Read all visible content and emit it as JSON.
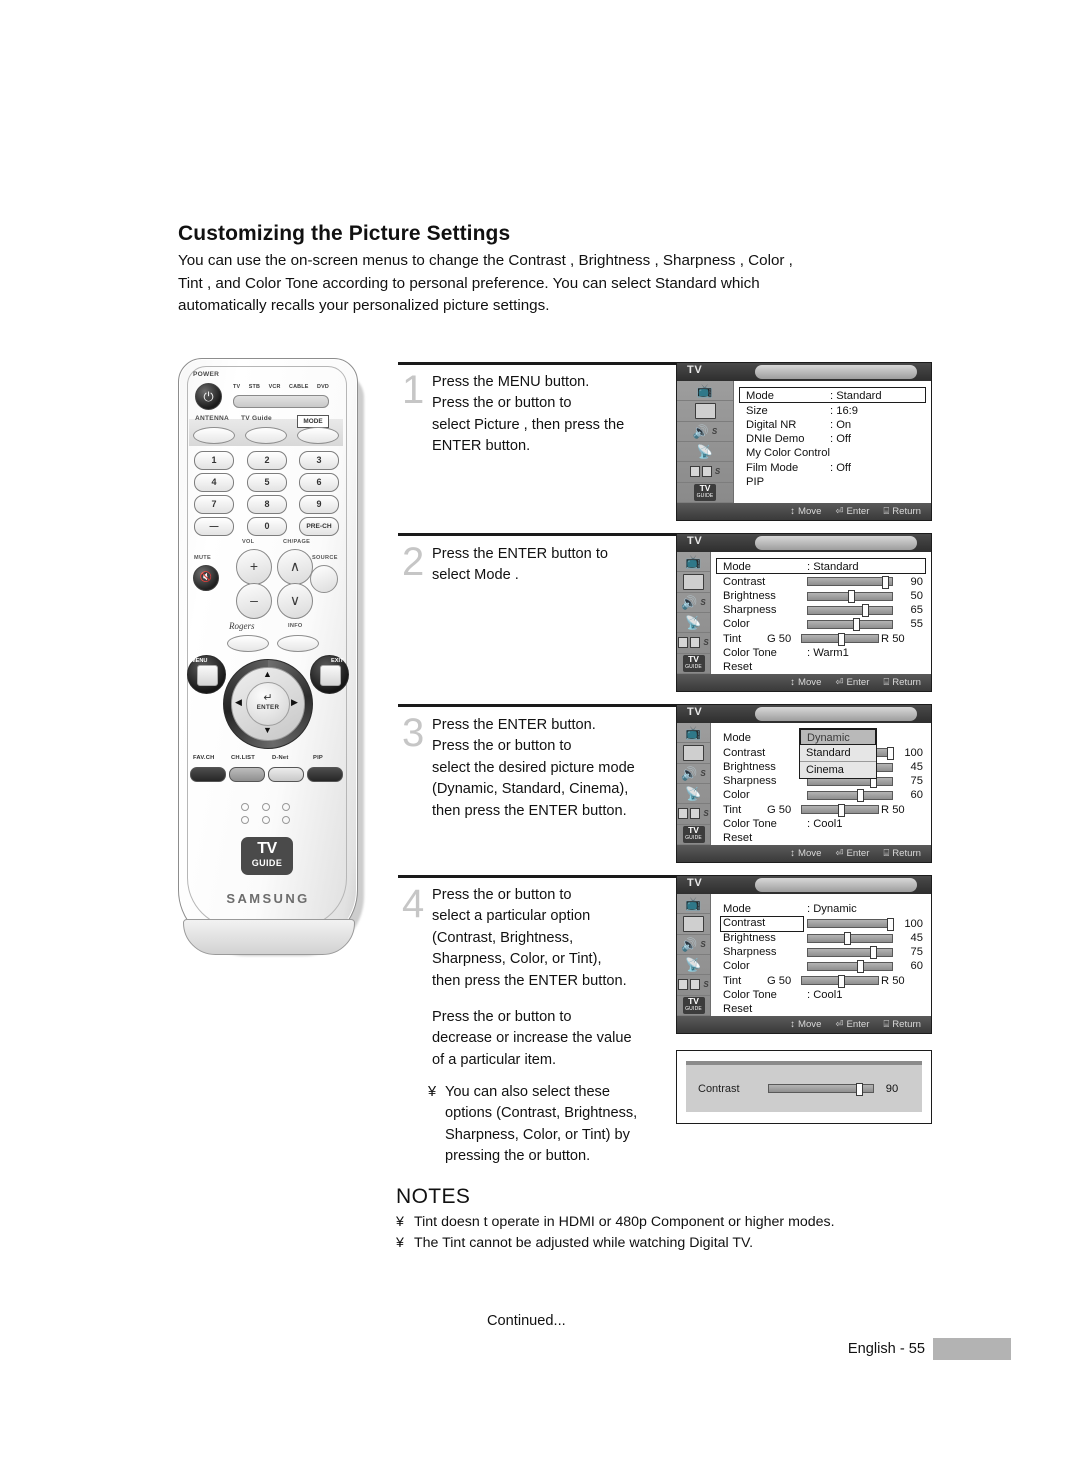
{
  "heading": "Customizing the Picture Settings",
  "intro": [
    "You can use the on-screen menus to change the  Contrast ,  Brightness ,  Sharpness ,  Color ,",
    " Tint , and  Color Tone  according to personal preference. You can select  Standard  which",
    "automatically recalls your personalized picture settings."
  ],
  "remote": {
    "power_label": "POWER",
    "power_icon": "power-icon",
    "device_keys": [
      "TV",
      "STB",
      "VCR",
      "CABLE",
      "DVD"
    ],
    "antenna_label": "ANTENNA",
    "tvguide_label": "TV Guide",
    "mode_label": "MODE",
    "numbers": [
      "1",
      "2",
      "3",
      "4",
      "5",
      "6",
      "7",
      "8",
      "9",
      "—",
      "0",
      "PRE-CH"
    ],
    "mute_label": "MUTE",
    "vol_label": "VOL",
    "chpage_label": "CH/PAGE",
    "source_label": "SOURCE",
    "vol_up": "+",
    "vol_down": "–",
    "ch_up": "∧",
    "ch_down": "∨",
    "rogers_label": "Rogers",
    "info_label": "INFO",
    "menu_label": "MENU",
    "exit_label": "EXIT",
    "enter_label": "ENTER",
    "bottom_keys": [
      "FAV.CH",
      "CH.LIST",
      "D-Net",
      "PIP"
    ],
    "tvguide_logo_line1": "TV",
    "tvguide_logo_line2": "GUIDE",
    "brand": "SAMSUNG"
  },
  "steps": [
    {
      "number": "1",
      "lines": [
        "Press the MENU button.",
        "Press the   or     button to",
        "select  Picture , then press the",
        "ENTER button."
      ]
    },
    {
      "number": "2",
      "lines": [
        "Press the ENTER button to",
        "select  Mode ."
      ]
    },
    {
      "number": "3",
      "lines": [
        "Press the ENTER button.",
        "Press the   or     button to",
        "select the desired picture mode",
        "(Dynamic, Standard, Cinema),",
        "then press the ENTER button."
      ]
    },
    {
      "number": "4",
      "lines": [
        "Press the   or     button to",
        "select a particular option",
        "(Contrast, Brightness,",
        "Sharpness, Color, or Tint),",
        "then press the ENTER button."
      ]
    }
  ],
  "step4_extra": {
    "lines": [
      "Press the   or     button to",
      "decrease or increase the value",
      "of a particular item."
    ],
    "bullet_mark": "¥",
    "bullet_lines": [
      "You can also select these",
      "options (Contrast, Brightness,",
      "Sharpness, Color, or Tint) by",
      "pressing the   or    button."
    ]
  },
  "osd_common": {
    "tv_tag": "TV",
    "footer": [
      {
        "icon": "↕",
        "label": "Move"
      },
      {
        "icon": "⏎",
        "label": "Enter"
      },
      {
        "icon": "⌸",
        "label": "Return"
      }
    ],
    "sidebar_icons": [
      "input-source-icon",
      "picture-icon",
      "sound-icon",
      "channel-dish-icon",
      "setup-icon",
      "tv-guide-icon"
    ],
    "sound_badge": "S",
    "setup_badge": "S",
    "tvguide_line1": "TV",
    "tvguide_line2": "GUIDE"
  },
  "osd1": {
    "rows": [
      {
        "label": "Mode",
        "value": ": Standard",
        "highlight": true
      },
      {
        "label": "Size",
        "value": ": 16:9"
      },
      {
        "label": "Digital NR",
        "value": ": On"
      },
      {
        "label": "DNIe Demo",
        "value": ": Off"
      },
      {
        "label": "My Color Control",
        "value": ""
      },
      {
        "label": "Film Mode",
        "value": ": Off"
      },
      {
        "label": "PIP",
        "value": ""
      }
    ]
  },
  "osd2": {
    "mode_label": "Mode",
    "mode_value": ": Standard",
    "sliders": [
      {
        "label": "Contrast",
        "value": "90",
        "pct": 88
      },
      {
        "label": "Brightness",
        "value": "50",
        "pct": 50
      },
      {
        "label": "Sharpness",
        "value": "65",
        "pct": 65
      },
      {
        "label": "Color",
        "value": "55",
        "pct": 55
      }
    ],
    "tint": {
      "label": "Tint",
      "left": "G 50",
      "right": "R 50",
      "pct": 50
    },
    "color_tone": {
      "label": "Color Tone",
      "value": ": Warm1"
    },
    "reset": "Reset"
  },
  "osd3": {
    "mode_label": "Mode",
    "dropdown_options": [
      "Dynamic",
      "Standard",
      "Cinema"
    ],
    "dropdown_selected": "Dynamic",
    "sliders": [
      {
        "label": "Contrast",
        "value": "100",
        "pct": 97
      },
      {
        "label": "Brightness",
        "value": "45",
        "pct": 45
      },
      {
        "label": "Sharpness",
        "value": "75",
        "pct": 75
      },
      {
        "label": "Color",
        "value": "60",
        "pct": 60
      }
    ],
    "tint": {
      "label": "Tint",
      "left": "G 50",
      "right": "R 50",
      "pct": 50
    },
    "color_tone": {
      "label": "Color Tone",
      "value": ": Cool1"
    },
    "reset": "Reset"
  },
  "osd4": {
    "mode_label": "Mode",
    "mode_value": ": Dynamic",
    "sliders": [
      {
        "label": "Contrast",
        "value": "100",
        "pct": 97,
        "highlight": true
      },
      {
        "label": "Brightness",
        "value": "45",
        "pct": 45
      },
      {
        "label": "Sharpness",
        "value": "75",
        "pct": 75
      },
      {
        "label": "Color",
        "value": "60",
        "pct": 60
      }
    ],
    "tint": {
      "label": "Tint",
      "left": "G 50",
      "right": "R 50",
      "pct": 50
    },
    "color_tone": {
      "label": "Color Tone",
      "value": ": Cool1"
    },
    "reset": "Reset"
  },
  "contrast_popup": {
    "label": "Contrast",
    "value": "90",
    "pct": 88
  },
  "notes": {
    "title": "NOTES",
    "items": [
      {
        "mark": "¥",
        "text": " Tint  doesn t operate in HDMI or 480p Component or higher modes."
      },
      {
        "mark": "¥",
        "text": "The Tint cannot be adjusted while watching Digital TV."
      }
    ]
  },
  "footer": {
    "continued": "Continued...",
    "page": "English - 55"
  }
}
